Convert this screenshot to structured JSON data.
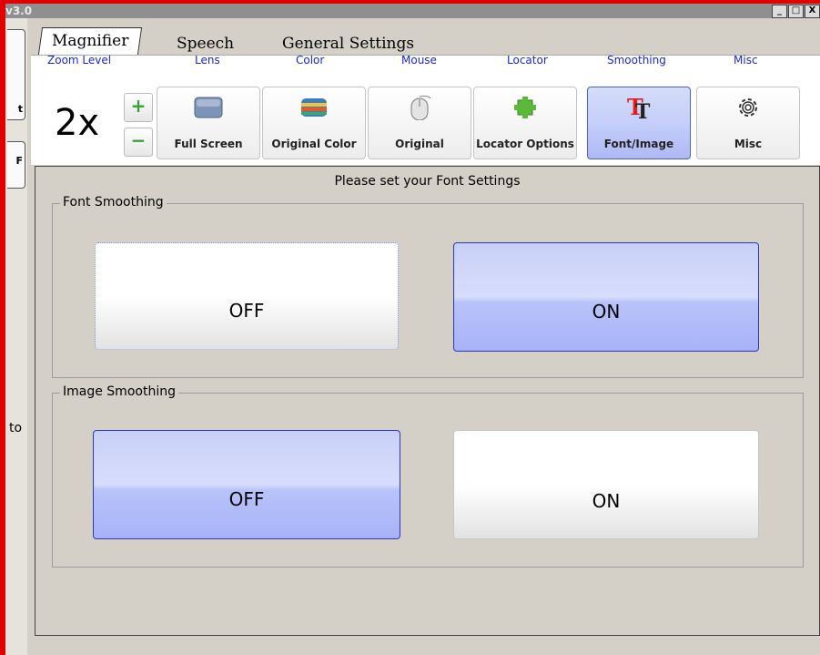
{
  "window": {
    "title": "v3.0",
    "controls": [
      "_",
      "□",
      "X"
    ]
  },
  "left_panel": {
    "button_top": "t",
    "button_f": "F",
    "text": "to"
  },
  "tabs": [
    {
      "label": "Magnifier",
      "active": true
    },
    {
      "label": "Speech",
      "active": false
    },
    {
      "label": "General Settings",
      "active": false
    }
  ],
  "toolbar": {
    "zoom": {
      "label": "Zoom Level",
      "value": "2x",
      "plus": "+",
      "minus": "−"
    },
    "tools": [
      {
        "section": "Lens",
        "label": "Full Screen",
        "icon": "lens-rect-icon",
        "active": false
      },
      {
        "section": "Color",
        "label": "Original Color",
        "icon": "color-stripes-icon",
        "active": false
      },
      {
        "section": "Mouse",
        "label": "Original",
        "icon": "mouse-icon",
        "active": false
      },
      {
        "section": "Locator",
        "label": "Locator Options",
        "icon": "locator-icon",
        "active": false
      },
      {
        "section": "Smoothing",
        "label": "Font/Image",
        "icon": "font-tt-icon",
        "active": true
      },
      {
        "section": "Misc",
        "label": "Misc",
        "icon": "gear-icon",
        "active": false
      }
    ]
  },
  "content": {
    "heading": "Please set your Font Settings",
    "font_smoothing": {
      "title": "Font Smoothing",
      "off": "OFF",
      "on": "ON",
      "selected": "ON"
    },
    "image_smoothing": {
      "title": "Image Smoothing",
      "off": "OFF",
      "on": "ON",
      "selected": "OFF"
    }
  },
  "colors": {
    "accent_label": "#1a27d6",
    "selected_border": "#2d35cf",
    "frame_red": "#e00000"
  }
}
